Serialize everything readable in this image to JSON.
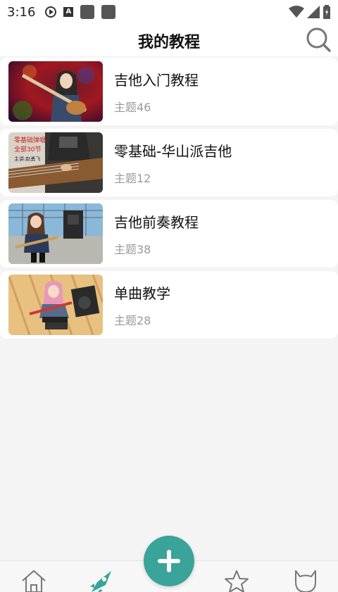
{
  "status": {
    "time": "3:16",
    "icons_left": [
      "play-icon",
      "a-icon",
      "app-square-icon",
      "app-square-icon"
    ],
    "icons_right": [
      "wifi-icon",
      "signal-icon",
      "battery-icon"
    ]
  },
  "header": {
    "title": "我的教程",
    "search_icon": "search-icon"
  },
  "tutorials": [
    {
      "title": "吉他入门教程",
      "subtitle": "主题46"
    },
    {
      "title": "零基础-华山派吉他",
      "subtitle": "主题12"
    },
    {
      "title": "吉他前奏教程",
      "subtitle": "主题38"
    },
    {
      "title": "单曲教学",
      "subtitle": "主题28"
    }
  ],
  "thumbnail_texts": {
    "card2_line1": "零基础弹唱",
    "card2_line2": "全部30节",
    "card2_line3": "主讲:赵勇飞"
  },
  "bottom_nav": {
    "items": [
      "home-icon",
      "rocket-icon",
      "add-icon",
      "star-icon",
      "cat-icon"
    ],
    "active": "rocket-icon"
  },
  "colors": {
    "accent": "#3aa39a",
    "page_bg": "#f4f4f4",
    "subtitle": "#9a9a9a"
  }
}
